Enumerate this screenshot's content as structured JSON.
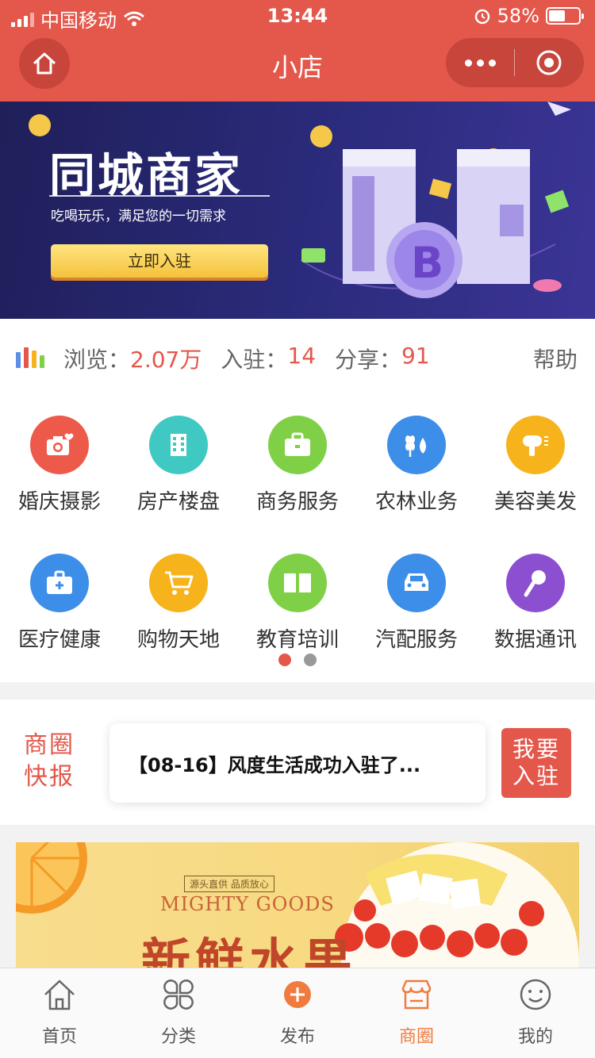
{
  "status": {
    "carrier": "中国移动",
    "time": "13:44",
    "battery": "58%"
  },
  "navbar": {
    "title": "小店"
  },
  "banner": {
    "title": "同城商家",
    "subtitle": "吃喝玩乐，满足您的一切需求",
    "button": "立即入驻"
  },
  "stats": {
    "browse_label": "浏览：",
    "browse_value": "2.07万",
    "join_label": "入驻：",
    "join_value": "14",
    "share_label": "分享：",
    "share_value": "91",
    "help": "帮助"
  },
  "categories": [
    {
      "label": "婚庆摄影",
      "icon": "camera-heart-icon",
      "color": "#ee5a4a"
    },
    {
      "label": "房产楼盘",
      "icon": "building-icon",
      "color": "#3fc9c2"
    },
    {
      "label": "商务服务",
      "icon": "briefcase-icon",
      "color": "#7fd046"
    },
    {
      "label": "农林业务",
      "icon": "wheat-drop-icon",
      "color": "#3d8ee8"
    },
    {
      "label": "美容美发",
      "icon": "hair-dryer-icon",
      "color": "#f6b31c"
    },
    {
      "label": "医疗健康",
      "icon": "medical-kit-icon",
      "color": "#3d8ee8"
    },
    {
      "label": "购物天地",
      "icon": "cart-icon",
      "color": "#f6b31c"
    },
    {
      "label": "教育培训",
      "icon": "book-icon",
      "color": "#7fd046"
    },
    {
      "label": "汽配服务",
      "icon": "car-icon",
      "color": "#3d8ee8"
    },
    {
      "label": "数据通讯",
      "icon": "microphone-icon",
      "color": "#8b4fd0"
    }
  ],
  "pager": {
    "active_color": "#e4574b",
    "inactive_color": "#999999"
  },
  "news": {
    "tag_line1": "商圈",
    "tag_line2": "快报",
    "headline": "【08-16】风度生活成功入驻了...",
    "join_line1": "我要",
    "join_line2": "入驻"
  },
  "fruit_banner": {
    "small": "源头直供 品质放心",
    "english": "MIGHTY GOODS",
    "title": "新鲜水果"
  },
  "tabs": [
    {
      "label": "首页",
      "icon": "home-icon"
    },
    {
      "label": "分类",
      "icon": "category-icon"
    },
    {
      "label": "发布",
      "icon": "plus-icon"
    },
    {
      "label": "商圈",
      "icon": "store-icon",
      "active": true
    },
    {
      "label": "我的",
      "icon": "smile-icon"
    }
  ],
  "colors": {
    "primary": "#e4574b",
    "tab_active": "#f07b3f"
  }
}
